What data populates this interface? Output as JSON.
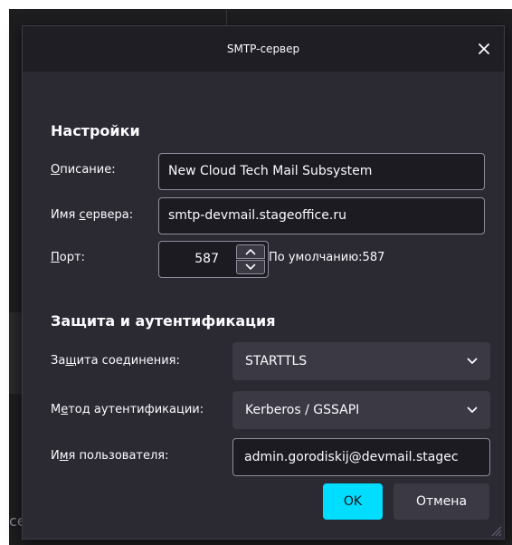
{
  "dialog": {
    "title": "SMTP-сервер",
    "close_icon": "close-icon"
  },
  "settings": {
    "heading": "Настройки",
    "description": {
      "label_accel": "О",
      "label_rest": "писание:",
      "value": "New Cloud Tech Mail Subsystem"
    },
    "server": {
      "label_pre": "Имя ",
      "label_accel": "с",
      "label_rest": "ервера:",
      "value": "smtp-devmail.stageoffice.ru"
    },
    "port": {
      "label_accel": "П",
      "label_rest": "орт:",
      "value": "587",
      "default_text": "По умолчанию:587",
      "up_icon": "chevron-up-icon",
      "down_icon": "chevron-down-icon"
    }
  },
  "security": {
    "heading": "Защита и аутентификация",
    "connection": {
      "label_pre": "За",
      "label_accel": "щ",
      "label_rest": "ита соединения:",
      "value": "STARTTLS"
    },
    "auth_method": {
      "label_pre": "М",
      "label_accel": "е",
      "label_rest": "тод аутентификации:",
      "value": "Kerberos / GSSAPI"
    },
    "username": {
      "label_pre": "И",
      "label_accel": "м",
      "label_rest": "я пользователя:",
      "value": "admin.gorodiskij@devmail.stagec"
    }
  },
  "buttons": {
    "ok": "OK",
    "cancel": "Отмена"
  },
  "background": {
    "fragment_text": "ce"
  },
  "colors": {
    "accent": "#00ddff",
    "dialog_bg": "#2b2a33",
    "titlebar_bg": "#1f1e25",
    "field_bg": "#1c1b22",
    "button_bg": "#3a3944",
    "text": "#fbfbfe"
  }
}
